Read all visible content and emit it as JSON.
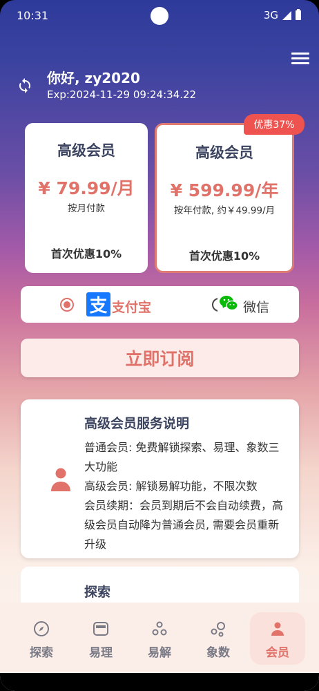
{
  "status_bar": {
    "time": "10:31",
    "network": "3G"
  },
  "header": {
    "greeting": "你好, zy2020",
    "expiry": "Exp:2024-11-29 09:24:34.22"
  },
  "plans": [
    {
      "title": "高级会员",
      "price": "¥ 79.99/月",
      "subtitle": "按月付款",
      "discount": "首次优惠10%"
    },
    {
      "title": "高级会员",
      "price": "¥ 599.99/年",
      "subtitle": "按年付款, 约￥49.99/月",
      "discount": "首次优惠10%",
      "badge": "优惠37%"
    }
  ],
  "payment": {
    "alipay_glyph": "支",
    "alipay_label": "支付宝",
    "wechat_label": "微信",
    "selected": "alipay"
  },
  "subscribe_label": "立即订阅",
  "info": {
    "title": "高级会员服务说明",
    "lines": [
      "普通会员: 免费解锁探索、易理、象数三大功能",
      "高级会员: 解锁易解功能，不限次数",
      "会员续期：会员到期后不会自动续费，高级会员自动降为普通会员, 需要会员重新升级"
    ]
  },
  "info2": {
    "title": "探索"
  },
  "nav": {
    "items": [
      {
        "label": "探索",
        "icon": "compass-icon"
      },
      {
        "label": "易理",
        "icon": "card-icon"
      },
      {
        "label": "易解",
        "icon": "dots-icon"
      },
      {
        "label": "象数",
        "icon": "bubbles-icon"
      },
      {
        "label": "会员",
        "icon": "person-icon"
      }
    ],
    "active": 4
  },
  "colors": {
    "accent": "#e0726a",
    "badge": "#ef5350",
    "alipay": "#1677ff",
    "wechat": "#09bb07",
    "nav_inactive": "#7a7a86"
  }
}
